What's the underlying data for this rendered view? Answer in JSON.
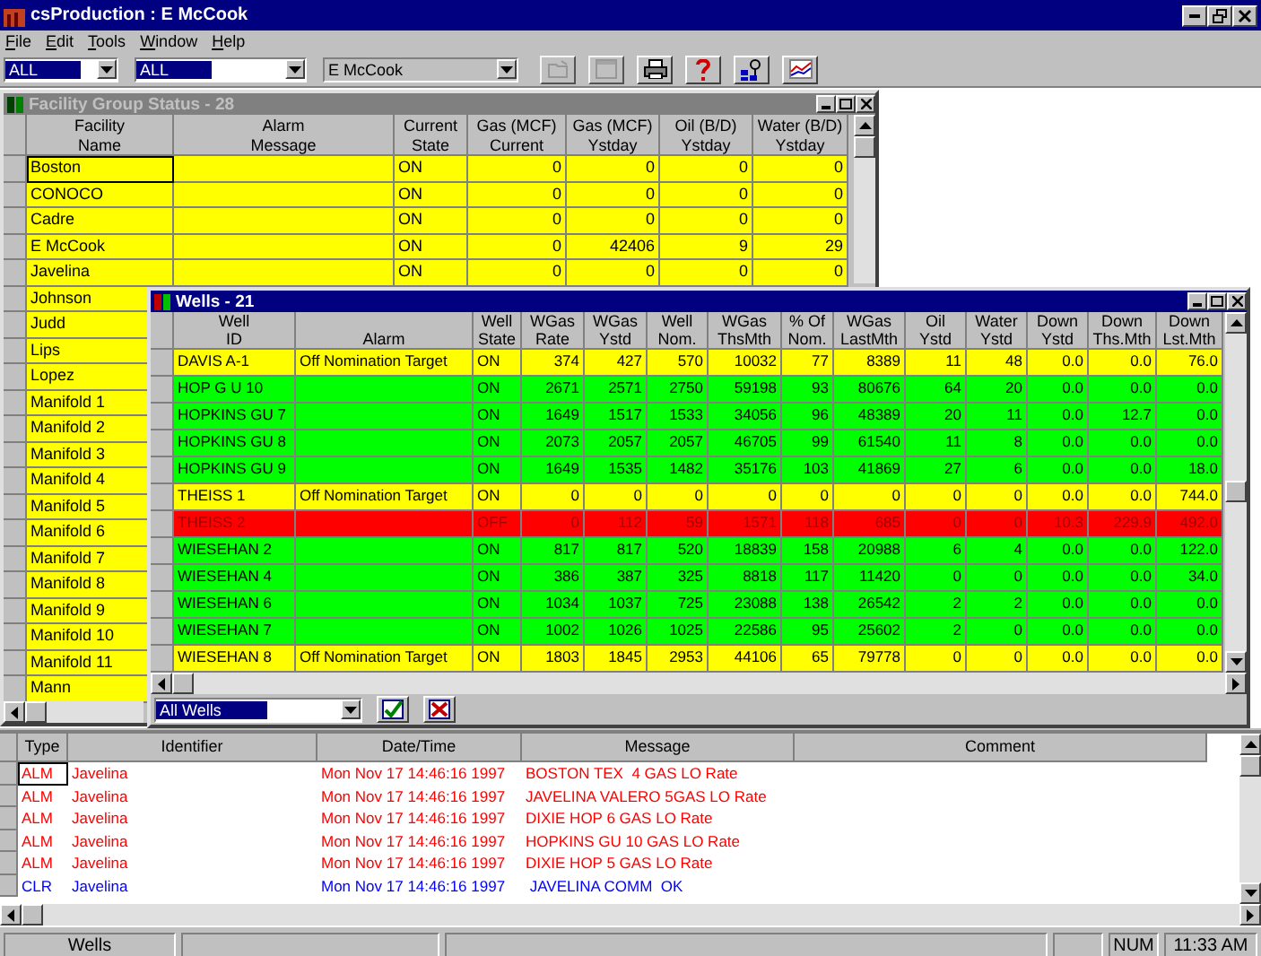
{
  "window": {
    "title": "csProduction : E McCook"
  },
  "menu": [
    "File",
    "Edit",
    "Tools",
    "Window",
    "Help"
  ],
  "toolbar": {
    "combos": [
      {
        "value": "ALL",
        "selected": true,
        "disabled": false
      },
      {
        "value": "ALL",
        "selected": true,
        "disabled": false
      },
      {
        "value": "E McCook",
        "selected": false,
        "disabled": true
      }
    ],
    "buttons": [
      {
        "kind": "folder",
        "disabled": true
      },
      {
        "kind": "window",
        "disabled": true
      },
      {
        "kind": "printer",
        "disabled": false
      },
      {
        "kind": "help",
        "disabled": false
      },
      {
        "kind": "pin",
        "disabled": false
      },
      {
        "kind": "chart",
        "disabled": false
      }
    ]
  },
  "facility_window": {
    "title": "Facility Group Status - 28",
    "active": false,
    "columns": [
      [
        "Facility",
        "Name"
      ],
      [
        "Alarm",
        "Message"
      ],
      [
        "Current",
        "State"
      ],
      [
        "Gas (MCF)",
        "Current"
      ],
      [
        "Gas (MCF)",
        "Ystday"
      ],
      [
        "Oil (B/D)",
        "Ystday"
      ],
      [
        "Water (B/D)",
        "Ystday"
      ]
    ],
    "rows": [
      {
        "name": "Boston",
        "selected": true,
        "state": "ON",
        "values": [
          "0",
          "0",
          "0",
          "0"
        ]
      },
      {
        "name": "CONOCO",
        "selected": false,
        "state": "ON",
        "values": [
          "0",
          "0",
          "0",
          "0"
        ]
      },
      {
        "name": "Cadre",
        "selected": false,
        "state": "ON",
        "values": [
          "0",
          "0",
          "0",
          "0"
        ]
      },
      {
        "name": "E McCook",
        "selected": false,
        "state": "ON",
        "values": [
          "0",
          "42406",
          "9",
          "29"
        ]
      },
      {
        "name": "Javelina",
        "selected": false,
        "state": "ON",
        "values": [
          "0",
          "0",
          "0",
          "0"
        ]
      },
      {
        "name": "Johnson",
        "selected": false
      },
      {
        "name": "Judd",
        "selected": false
      },
      {
        "name": "Lips",
        "selected": false
      },
      {
        "name": "Lopez",
        "selected": false
      },
      {
        "name": "Manifold  1",
        "selected": false
      },
      {
        "name": "Manifold  2",
        "selected": false
      },
      {
        "name": "Manifold  3",
        "selected": false
      },
      {
        "name": "Manifold  4",
        "selected": false
      },
      {
        "name": "Manifold  5",
        "selected": false
      },
      {
        "name": "Manifold  6",
        "selected": false
      },
      {
        "name": "Manifold  7",
        "selected": false
      },
      {
        "name": "Manifold  8",
        "selected": false
      },
      {
        "name": "Manifold  9",
        "selected": false
      },
      {
        "name": "Manifold 10",
        "selected": false
      },
      {
        "name": "Manifold 11",
        "selected": false
      },
      {
        "name": "Mann",
        "selected": false
      }
    ]
  },
  "wells_window": {
    "title": "Wells - 21",
    "active": true,
    "columns": [
      [
        "Well",
        "ID"
      ],
      [
        "",
        "Alarm"
      ],
      [
        "Well",
        "State"
      ],
      [
        "WGas",
        "Rate"
      ],
      [
        "WGas",
        "Ystd"
      ],
      [
        "Well",
        "Nom."
      ],
      [
        "WGas",
        "ThsMth"
      ],
      [
        "% Of",
        "Nom."
      ],
      [
        "WGas",
        "LastMth"
      ],
      [
        "Oil",
        "Ystd"
      ],
      [
        "Water",
        "Ystd"
      ],
      [
        "Down",
        "Ystd"
      ],
      [
        "Down",
        "Ths.Mth"
      ],
      [
        "Down",
        "Lst.Mth"
      ]
    ],
    "rows": [
      {
        "id": "DAVIS A-1",
        "alarm": "Off Nomination Target",
        "state": "ON",
        "color": "#ffff00",
        "values": [
          "374",
          "427",
          "570",
          "10032",
          "77",
          "8389",
          "11",
          "48",
          "0.0",
          "0.0",
          "76.0"
        ]
      },
      {
        "id": "HOP G U 10",
        "state": "ON",
        "color": "#00ff00",
        "values": [
          "2671",
          "2571",
          "2750",
          "59198",
          "93",
          "80676",
          "64",
          "20",
          "0.0",
          "0.0",
          "0.0"
        ]
      },
      {
        "id": "HOPKINS GU 7",
        "state": "ON",
        "color": "#00ff00",
        "values": [
          "1649",
          "1517",
          "1533",
          "34056",
          "96",
          "48389",
          "20",
          "11",
          "0.0",
          "12.7",
          "0.0"
        ]
      },
      {
        "id": "HOPKINS GU 8",
        "state": "ON",
        "color": "#00ff00",
        "values": [
          "2073",
          "2057",
          "2057",
          "46705",
          "99",
          "61540",
          "11",
          "8",
          "0.0",
          "0.0",
          "0.0"
        ]
      },
      {
        "id": "HOPKINS GU 9",
        "state": "ON",
        "color": "#00ff00",
        "values": [
          "1649",
          "1535",
          "1482",
          "35176",
          "103",
          "41869",
          "27",
          "6",
          "0.0",
          "0.0",
          "18.0"
        ]
      },
      {
        "id": "THEISS 1",
        "alarm": "Off Nomination Target",
        "state": "ON",
        "color": "#ffff00",
        "values": [
          "0",
          "0",
          "0",
          "0",
          "0",
          "0",
          "0",
          "0",
          "0.0",
          "0.0",
          "744.0"
        ]
      },
      {
        "id": "THEISS 2",
        "state": "OFF",
        "color": "#ff0000",
        "values": [
          "0",
          "112",
          "59",
          "1571",
          "118",
          "685",
          "0",
          "0",
          "10.3",
          "229.9",
          "492.0"
        ]
      },
      {
        "id": "WIESEHAN 2",
        "state": "ON",
        "color": "#00ff00",
        "values": [
          "817",
          "817",
          "520",
          "18839",
          "158",
          "20988",
          "6",
          "4",
          "0.0",
          "0.0",
          "122.0"
        ]
      },
      {
        "id": "WIESEHAN 4",
        "state": "ON",
        "color": "#00ff00",
        "values": [
          "386",
          "387",
          "325",
          "8818",
          "117",
          "11420",
          "0",
          "0",
          "0.0",
          "0.0",
          "34.0"
        ]
      },
      {
        "id": "WIESEHAN 6",
        "state": "ON",
        "color": "#00ff00",
        "values": [
          "1034",
          "1037",
          "725",
          "23088",
          "138",
          "26542",
          "2",
          "2",
          "0.0",
          "0.0",
          "0.0"
        ]
      },
      {
        "id": "WIESEHAN 7",
        "state": "ON",
        "color": "#00ff00",
        "values": [
          "1002",
          "1026",
          "1025",
          "22586",
          "95",
          "25602",
          "2",
          "0",
          "0.0",
          "0.0",
          "0.0"
        ]
      },
      {
        "id": "WIESEHAN 8",
        "alarm": "Off Nomination Target",
        "state": "ON",
        "color": "#ffff00",
        "values": [
          "1803",
          "1845",
          "2953",
          "44106",
          "65",
          "79778",
          "0",
          "0",
          "0.0",
          "0.0",
          "0.0"
        ]
      }
    ],
    "filter": {
      "value": "All Wells"
    }
  },
  "log": {
    "columns": [
      "Type",
      "Identifier",
      "Date/Time",
      "Message",
      "Comment"
    ],
    "rows": [
      {
        "type": "ALM",
        "identifier": "Javelina",
        "datetime": "Mon Nov 17 14:46:16 1997",
        "message": "BOSTON TEX  4 GAS LO Rate",
        "color": "#ff0000",
        "selected": true
      },
      {
        "type": "ALM",
        "identifier": "Javelina",
        "datetime": "Mon Nov 17 14:46:16 1997",
        "message": "JAVELINA VALERO 5GAS LO Rate",
        "color": "#ff0000",
        "selected": false
      },
      {
        "type": "ALM",
        "identifier": "Javelina",
        "datetime": "Mon Nov 17 14:46:16 1997",
        "message": "DIXIE HOP 6 GAS LO Rate",
        "color": "#ff0000",
        "selected": false
      },
      {
        "type": "ALM",
        "identifier": "Javelina",
        "datetime": "Mon Nov 17 14:46:16 1997",
        "message": "HOPKINS GU 10 GAS LO Rate",
        "color": "#ff0000",
        "selected": false
      },
      {
        "type": "ALM",
        "identifier": "Javelina",
        "datetime": "Mon Nov 17 14:46:16 1997",
        "message": "DIXIE HOP 5 GAS LO Rate",
        "color": "#ff0000",
        "selected": false
      },
      {
        "type": "CLR",
        "identifier": "Javelina",
        "datetime": "Mon Nov 17 14:46:16 1997",
        "message": " JAVELINA COMM  OK",
        "color": "#0000ff",
        "selected": false
      }
    ]
  },
  "status_bar": {
    "panel": "Wells",
    "indicator": "NUM",
    "time": "11:33 AM"
  }
}
